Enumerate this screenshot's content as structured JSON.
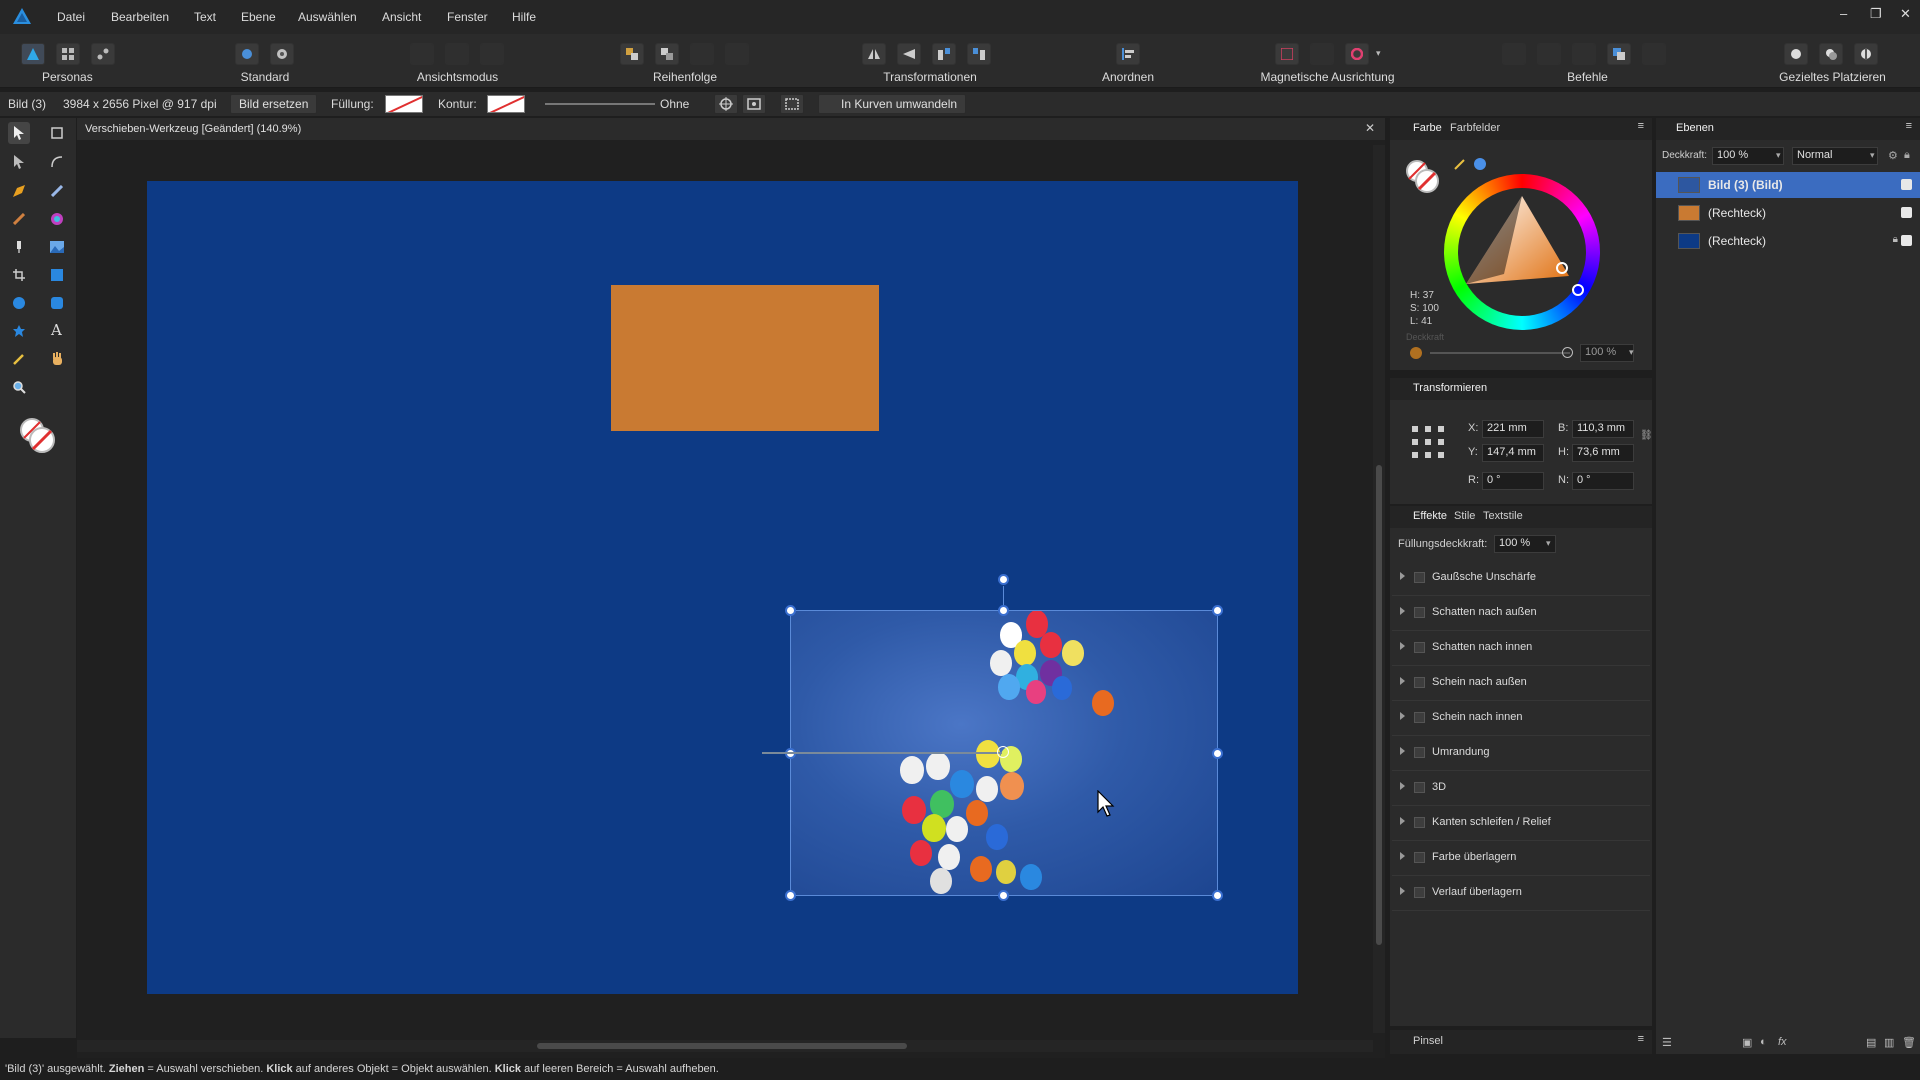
{
  "menu": [
    "Datei",
    "Bearbeiten",
    "Text",
    "Ebene",
    "Auswählen",
    "Ansicht",
    "Fenster",
    "Hilfe"
  ],
  "toolbar": {
    "personas": "Personas",
    "standard": "Standard",
    "ansichtsmodus": "Ansichtsmodus",
    "reihenfolge": "Reihenfolge",
    "transformationen": "Transformationen",
    "anordnen": "Anordnen",
    "magnetische": "Magnetische Ausrichtung",
    "befehle": "Befehle",
    "gezieltes": "Gezieltes Platzieren"
  },
  "context": {
    "object": "Bild (3)",
    "info": "3984 x 2656 Pixel @ 917 dpi",
    "replace": "Bild ersetzen",
    "fill": "Füllung:",
    "stroke": "Kontur:",
    "stroke_style": "Ohne",
    "convert": "In Kurven umwandeln"
  },
  "document": {
    "title": "Verschieben-Werkzeug [Geändert] (140.9%)"
  },
  "color_panel": {
    "tabs": [
      "Farbe",
      "Farbfelder"
    ],
    "h": "H: 37",
    "s": "S: 100",
    "l": "L: 41",
    "opacity_label": "Deckkraft",
    "opacity": "100 %"
  },
  "transform_panel": {
    "title": "Transformieren",
    "x_label": "X:",
    "x": "221 mm",
    "y_label": "Y:",
    "y": "147,4 mm",
    "w_label": "B:",
    "w": "110,3 mm",
    "h_label": "H:",
    "h": "73,6 mm",
    "r_label": "R:",
    "r": "0 °",
    "n_label": "N:",
    "n": "0 °"
  },
  "effects_panel": {
    "tabs": [
      "Effekte",
      "Stile",
      "Textstile"
    ],
    "fill_opacity_label": "Füllungsdeckkraft:",
    "fill_opacity": "100 %",
    "effects": [
      "Gaußsche Unschärfe",
      "Schatten nach außen",
      "Schatten nach innen",
      "Schein nach außen",
      "Schein nach innen",
      "Umrandung",
      "3D",
      "Kanten schleifen / Relief",
      "Farbe überlagern",
      "Verlauf überlagern"
    ]
  },
  "brush_panel": {
    "title": "Pinsel"
  },
  "layers_panel": {
    "title": "Ebenen",
    "opacity_label": "Deckkraft:",
    "opacity": "100 %",
    "blend": "Normal",
    "layers": [
      {
        "name": "Bild (3) (Bild)",
        "color": "#2d57a0",
        "selected": true
      },
      {
        "name": "(Rechteck)",
        "color": "#c97a32",
        "selected": false
      },
      {
        "name": "(Rechteck)",
        "color": "#0d3a85",
        "selected": false
      }
    ]
  },
  "status": {
    "quote": "'Bild (3)' ausgewählt. ",
    "b1": "Ziehen",
    "t1": " = Auswahl verschieben. ",
    "b2": "Klick",
    "t2": " auf anderes Objekt = Objekt auswählen. ",
    "b3": "Klick",
    "t3": " auf leeren Bereich = Auswahl aufheben."
  },
  "colors": {
    "artboard": "#0d3a85",
    "orange_rect": "#c97a32",
    "selection": "#3a6fd0",
    "app_bg": "#2b2b2b"
  }
}
